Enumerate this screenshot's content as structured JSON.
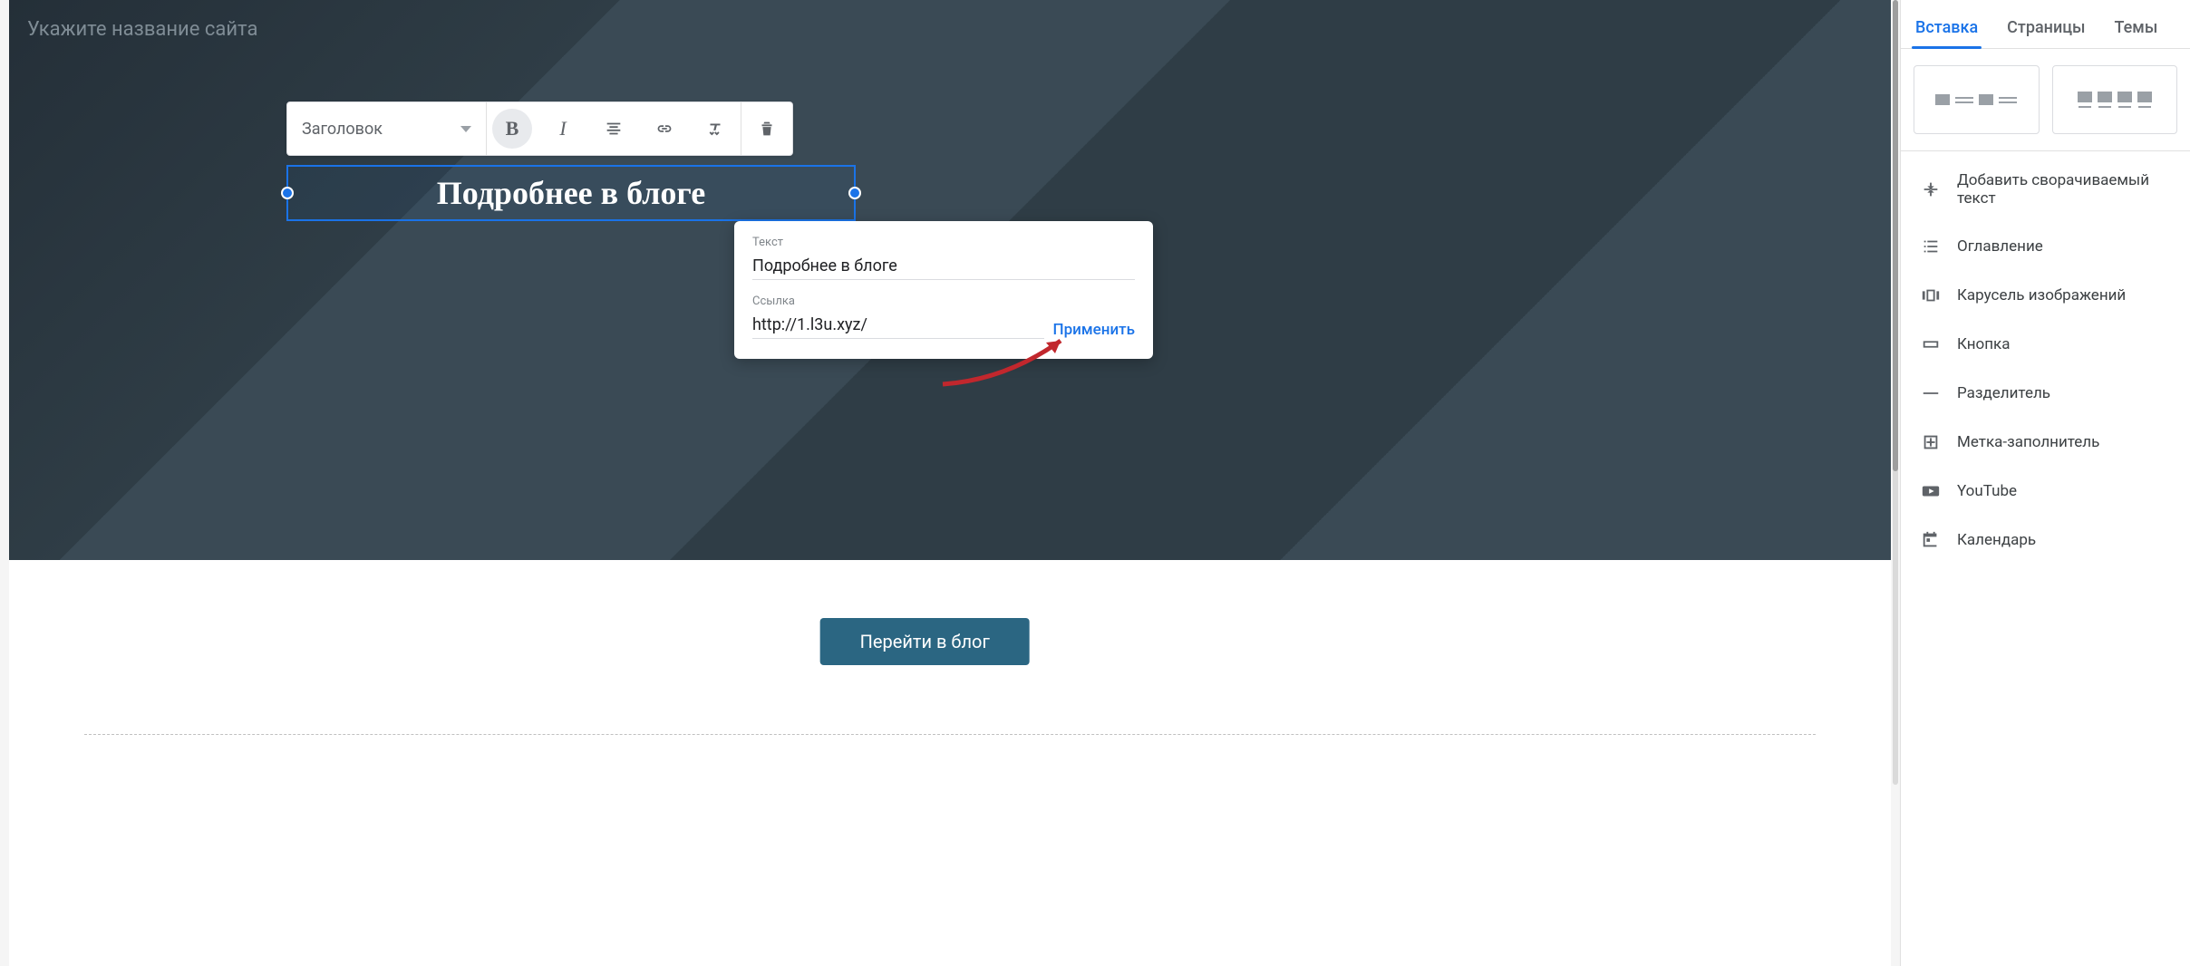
{
  "canvas": {
    "site_name_placeholder": "Укажите название сайта",
    "toolbar": {
      "style_label": "Заголовок"
    },
    "selected_text": "Подробнее в блоге",
    "blog_button_label": "Перейти в блог"
  },
  "link_popup": {
    "text_label": "Текст",
    "text_value": "Подробнее в блоге",
    "url_label": "Ссылка",
    "url_value": "http://1.l3u.xyz/",
    "apply_label": "Применить"
  },
  "sidebar": {
    "tabs": {
      "insert": "Вставка",
      "pages": "Страницы",
      "themes": "Темы"
    },
    "items": {
      "collapsible": "Добавить сворачиваемый текст",
      "toc": "Оглавление",
      "carousel": "Карусель изображений",
      "button": "Кнопка",
      "divider": "Разделитель",
      "placeholder": "Метка-заполнитель",
      "youtube": "YouTube",
      "calendar": "Календарь"
    }
  }
}
